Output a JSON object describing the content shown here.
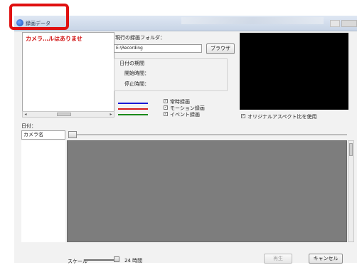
{
  "window": {
    "title": "録画データ"
  },
  "camera_list": {
    "message": "カメラ…ルはありませ"
  },
  "folder": {
    "label": "現行の録画フォルダ：",
    "value": "E:\\Recording",
    "browse_label": "ブラウザ"
  },
  "period": {
    "title": "日付の期間",
    "start_label": "開始時間：",
    "stop_label": "停止時間："
  },
  "legend": [
    {
      "label": "常時録画",
      "color": "#1a1ad6",
      "checked": true
    },
    {
      "label": "モーション録画",
      "color": "#d61a1a",
      "checked": true
    },
    {
      "label": "イベント録画",
      "color": "#1a8a1a",
      "checked": true
    }
  ],
  "preview": {
    "aspect_label": "オリジナルアスペクト比を使用",
    "aspect_checked": true
  },
  "timeline": {
    "date_label": "日付：",
    "camera_header": "カメラ名"
  },
  "scale": {
    "label": "スケール",
    "value": "24 時間"
  },
  "buttons": {
    "play": "再生",
    "cancel": "キャンセル"
  },
  "highlight_color": "#e01010"
}
